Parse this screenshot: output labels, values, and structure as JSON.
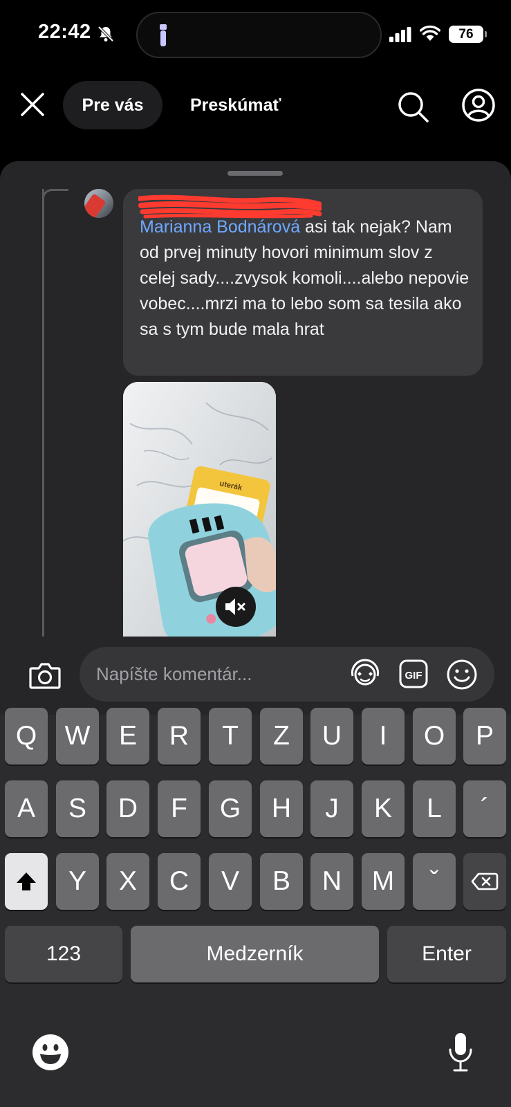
{
  "status_bar": {
    "time": "22:42",
    "battery": "76"
  },
  "nav": {
    "tab_active": "Pre vás",
    "tab_explore": "Preskúmať"
  },
  "comment": {
    "mention": "Marianna Bodnárová",
    "text": " asi tak nejak? Nam od prvej minuty hovori minimum slov z celej sady....zvysok komoli....alebo nepovie vobec....mrzi ma to lebo som sa tesila ako sa s tym bude mala hrat"
  },
  "media": {
    "card_word": "uterák"
  },
  "input": {
    "placeholder": "Napíšte komentár...",
    "gif_label": "GIF"
  },
  "keyboard": {
    "row1": [
      "Q",
      "W",
      "E",
      "R",
      "T",
      "Z",
      "U",
      "I",
      "O",
      "P"
    ],
    "row2": [
      "A",
      "S",
      "D",
      "F",
      "G",
      "H",
      "J",
      "K",
      "L",
      "´"
    ],
    "row3": [
      "Y",
      "X",
      "C",
      "V",
      "B",
      "N",
      "M",
      "ˇ"
    ],
    "numbers": "123",
    "space": "Medzerník",
    "enter": "Enter"
  },
  "colors": {
    "mention": "#6ea8ff",
    "redaction": "#ff3b30",
    "sheet": "#262629",
    "key": "#6b6b6e"
  },
  "icons": [
    "bell-slash-icon",
    "flashlight-icon",
    "signal-icon",
    "wifi-icon",
    "battery-icon",
    "close-icon",
    "search-icon",
    "profile-icon",
    "mute-icon",
    "camera-icon",
    "avatar-sticker-icon",
    "gif-icon",
    "smiley-icon",
    "shift-icon",
    "backspace-icon",
    "emoji-keyboard-icon",
    "microphone-icon"
  ]
}
